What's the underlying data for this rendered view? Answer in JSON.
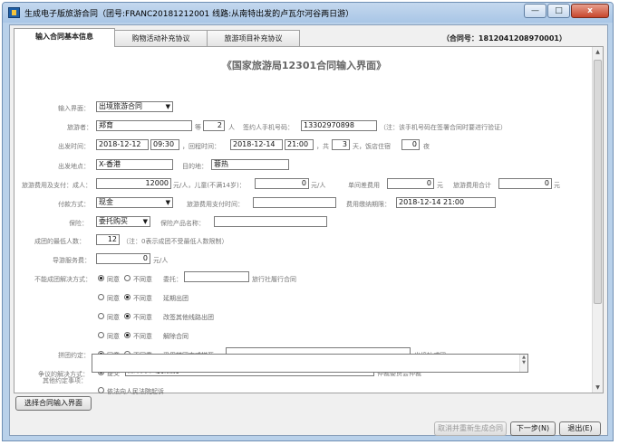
{
  "window": {
    "title": "生成电子版旅游合同（团号:FRANC20181212001  线路:从南特出发的卢瓦尔河谷两日游）",
    "minimize": "—",
    "maximize": "□",
    "close": "x"
  },
  "tabs": [
    {
      "label": "输入合同基本信息"
    },
    {
      "label": "购物活动补充协议"
    },
    {
      "label": "旅游项目补充协议"
    }
  ],
  "contract_no": "（合同号：1812041208970001）",
  "heading": "《国家旅游局12301合同输入界面》",
  "form": {
    "interface_label": "输入界面：",
    "interface_value": "出境旅游合同",
    "traveler_label": "旅游者：",
    "traveler_value": "郑育",
    "etc_label": "等",
    "count_value": "2",
    "person_unit": "人",
    "phone_label": "签约人手机号码：",
    "phone_value": "13302970898",
    "phone_note": "（注：该手机号码在签署合同时要进行验证）",
    "depart_label": "出发时间：",
    "depart_date": "2018-12-12",
    "depart_time": "09:30",
    "return_label": "，回程时间：",
    "return_date": "2018-12-14",
    "return_time": "21:00",
    "total_label": "，共",
    "days_value": "3",
    "days_unit": "天，饭店住宿",
    "nights_value": "0",
    "nights_unit": "夜",
    "origin_label": "出发地点：",
    "origin_value": "X-香港",
    "dest_label": "目的地：",
    "dest_value": "蓉热",
    "fee_label": "旅游费用及支付：成人：",
    "adult_fee": "12000",
    "adult_unit": "元/人，儿童(不满14岁)：",
    "child_fee": "0",
    "child_unit": "元/人",
    "single_label": "单间差费用",
    "single_fee": "0",
    "single_unit": "元",
    "total_fee_label": "旅游费用合计",
    "total_fee": "0",
    "total_fee_unit": "元",
    "pay_label": "付款方式：",
    "pay_value": "现金",
    "pay_time_label": "旅游费用支付时间：",
    "pay_time_value": "",
    "deadline_label": "费用缴纳期限：",
    "deadline_value": "2018-12-14 21:00",
    "insurance_label": "保险：",
    "insurance_value": "委托购买",
    "product_label": "保险产品名称：",
    "product_value": "",
    "min_label": "成团的最低人数：",
    "min_value": "12",
    "min_note": "（注：0表示成团不受最低人数限制）",
    "guide_label": "导游服务费：",
    "guide_value": "0",
    "guide_unit": "元/人",
    "fail_label": "不能成团解决方式：",
    "agree": "同意",
    "disagree": "不同意",
    "entrust_label": "委托：",
    "entrust_value": "",
    "entrust_suffix": "旅行社履行合同",
    "delay_text": "延期出团",
    "other_route_text": "改签其他线路出团",
    "cancel_text": "解除合同",
    "merge_label": "拼团约定：",
    "merge_prefix": "采用拼团方式拼至",
    "merge_value": "",
    "merge_suffix": "出境社成团",
    "dispute_label": "争议的解决方式：",
    "submit_text": "提交",
    "arbitration_value": "深圳市人民法院1",
    "arbitration_suffix": "仲裁委员会仲裁",
    "court_text": "依法向人民法院起诉",
    "other_label": "其他约定事项："
  },
  "buttons": {
    "select_interface": "选择合同输入界面",
    "cancel_regen": "取消并重新生成合同",
    "next": "下一步(N)",
    "exit": "退出(E)"
  }
}
